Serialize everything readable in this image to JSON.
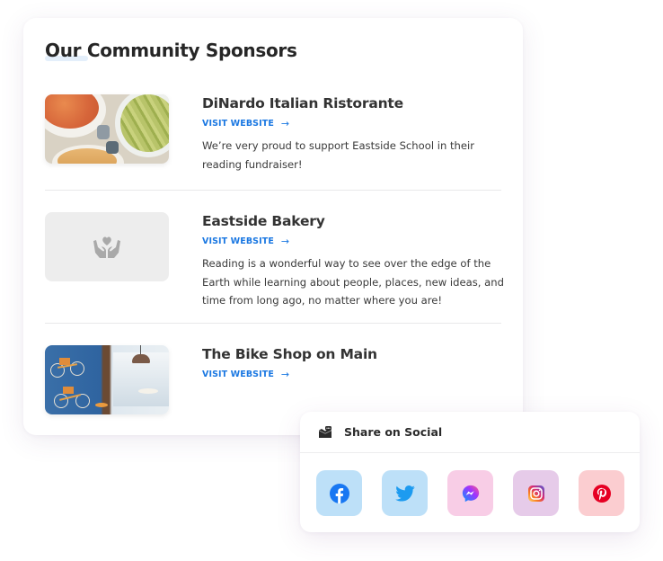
{
  "sponsors_card": {
    "title": "Our Community Sponsors",
    "sponsors": [
      {
        "name": "DiNardo Italian Ristorante",
        "link_label": "VISIT WEBSITE",
        "link_arrow": "→",
        "description": "We’re very proud to support Eastside School in their reading fundraiser!",
        "image": "restaurant-food-photo"
      },
      {
        "name": "Eastside Bakery",
        "link_label": "VISIT WEBSITE",
        "link_arrow": "→",
        "description": "Reading is a wonderful way to see over the edge of the Earth while learning about people, places, new ideas, and time from long ago, no matter where you are!",
        "image": "placeholder-hands-heart-icon"
      },
      {
        "name": "The Bike Shop on Main",
        "link_label": "VISIT WEBSITE",
        "link_arrow": "→",
        "description": "",
        "image": "bike-shop-interior-photo"
      }
    ]
  },
  "share_card": {
    "title": "Share on Social",
    "icon": "share-envelope-icon",
    "buttons": [
      {
        "network": "Facebook",
        "icon": "facebook-icon",
        "bg": "#bde0f8",
        "color": "#1877f2"
      },
      {
        "network": "Twitter",
        "icon": "twitter-icon",
        "bg": "#bde0f8",
        "color": "#1d9bf0"
      },
      {
        "network": "Messenger",
        "icon": "messenger-icon",
        "bg": "#f8cde6",
        "color": "#a33bf0"
      },
      {
        "network": "Instagram",
        "icon": "instagram-icon",
        "bg": "#e6cbe9",
        "color": "#d62976"
      },
      {
        "network": "Pinterest",
        "icon": "pinterest-icon",
        "bg": "#fbcdd0",
        "color": "#e60023"
      }
    ]
  },
  "colors": {
    "link": "#1b78e2",
    "heading": "#262626",
    "title_highlight": "#e4effb"
  }
}
